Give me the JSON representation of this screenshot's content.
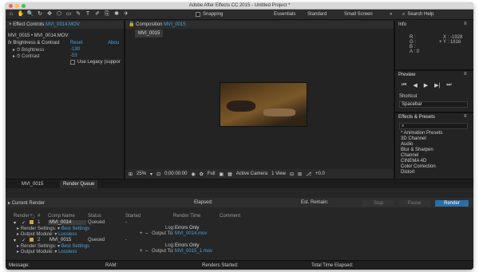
{
  "window": {
    "title": "Adobe After Effects CC 2015 - Untitled Project *"
  },
  "toolbar": {
    "tools": [
      "⌂",
      "✋",
      "🔍",
      "↻",
      "✥",
      "⬡",
      "▭",
      "✎",
      "T",
      "✐",
      "⎘",
      "✱",
      "✈"
    ],
    "tool_icons": [
      "home-icon",
      "hand-icon",
      "zoom-icon",
      "rotate-icon",
      "orbit-icon",
      "pan-icon",
      "shape-icon",
      "pen-icon",
      "text-icon",
      "brush-icon",
      "clone-icon",
      "eraser-icon",
      "puppet-icon"
    ],
    "snapping_label": "Snapping",
    "workspaces": [
      "Essentials",
      "Standard",
      "Small Screen"
    ],
    "search_label": "Search Help"
  },
  "effect_controls": {
    "tab_label": "Effect Controls",
    "tab_file": "MVI_0014.MOV",
    "layer_path": "MVI_0015 • MVI_0014.MOV",
    "effect_name": "Brightness & Contrast",
    "reset_label": "Reset",
    "about_label": "Abou",
    "brightness_label": "Brightness",
    "brightness_value": "-130",
    "contrast_label": "Contrast",
    "contrast_value": "-53",
    "legacy_label": "Use Legacy (suppor"
  },
  "composition": {
    "tab_label": "Composition",
    "tab_comp": "MVI_0015",
    "comp_tab": "MVI_0015",
    "zoom": "25%",
    "timecode": "0;00:00:00",
    "resolution": "Full",
    "camera": "Active Camera",
    "views": "1 View",
    "offset": "+0.0"
  },
  "info": {
    "title": "Info",
    "r_label": "R :",
    "g_label": "G :",
    "b_label": "B :",
    "a_label": "A : 0",
    "x_label": "X : -1928",
    "y_label": "Y : 1816"
  },
  "preview": {
    "title": "Preview",
    "shortcut_label": "Shortcut",
    "shortcut_value": "Spacebar"
  },
  "effects_presets": {
    "title": "Effects & Presets",
    "items": [
      "* Animation Presets",
      "3D Channel",
      "Audio",
      "Blur & Sharpen",
      "Channel",
      "CINEMA 4D",
      "Color Correction",
      "Distort"
    ]
  },
  "bottom_tabs": {
    "comp_tab": "MVI_0015",
    "render_tab": "Render Queue"
  },
  "render_queue": {
    "current_render": "Current Render",
    "elapsed": "Elapsed:",
    "est_remain": "Est. Remain:",
    "stop": "Stop",
    "pause": "Pause",
    "render": "Render",
    "columns": [
      "Render",
      "#",
      "Comp Name",
      "Status",
      "Started",
      "Render Time",
      "Comment"
    ],
    "items": [
      {
        "index": "1",
        "comp": "MVI_0014",
        "status": "Queued",
        "started": "-",
        "settings_label": "Render Settings:",
        "settings_value": "Best Settings",
        "module_label": "Output Module:",
        "module_value": "Lossless",
        "log_label": "Log:",
        "log_value": "Errors Only",
        "output_label": "Output To:",
        "output_value": "MVI_0014.mov"
      },
      {
        "index": "2",
        "comp": "MVI_0015",
        "status": "Queued",
        "started": "-",
        "settings_label": "Render Settings:",
        "settings_value": "Best Settings",
        "module_label": "Output Module:",
        "module_value": "Lossless",
        "log_label": "Log:",
        "log_value": "Errors Only",
        "output_label": "Output To:",
        "output_value": "MVI_0015_1.mov"
      }
    ],
    "footer": {
      "message": "Message:",
      "ram": "RAM:",
      "renders_started": "Renders Started:",
      "total_time": "Total Time Elapsed:"
    }
  },
  "colors": {
    "accent": "#4aa3df",
    "render_button": "#2e6da4",
    "label_swatch": "#c8a64a"
  }
}
